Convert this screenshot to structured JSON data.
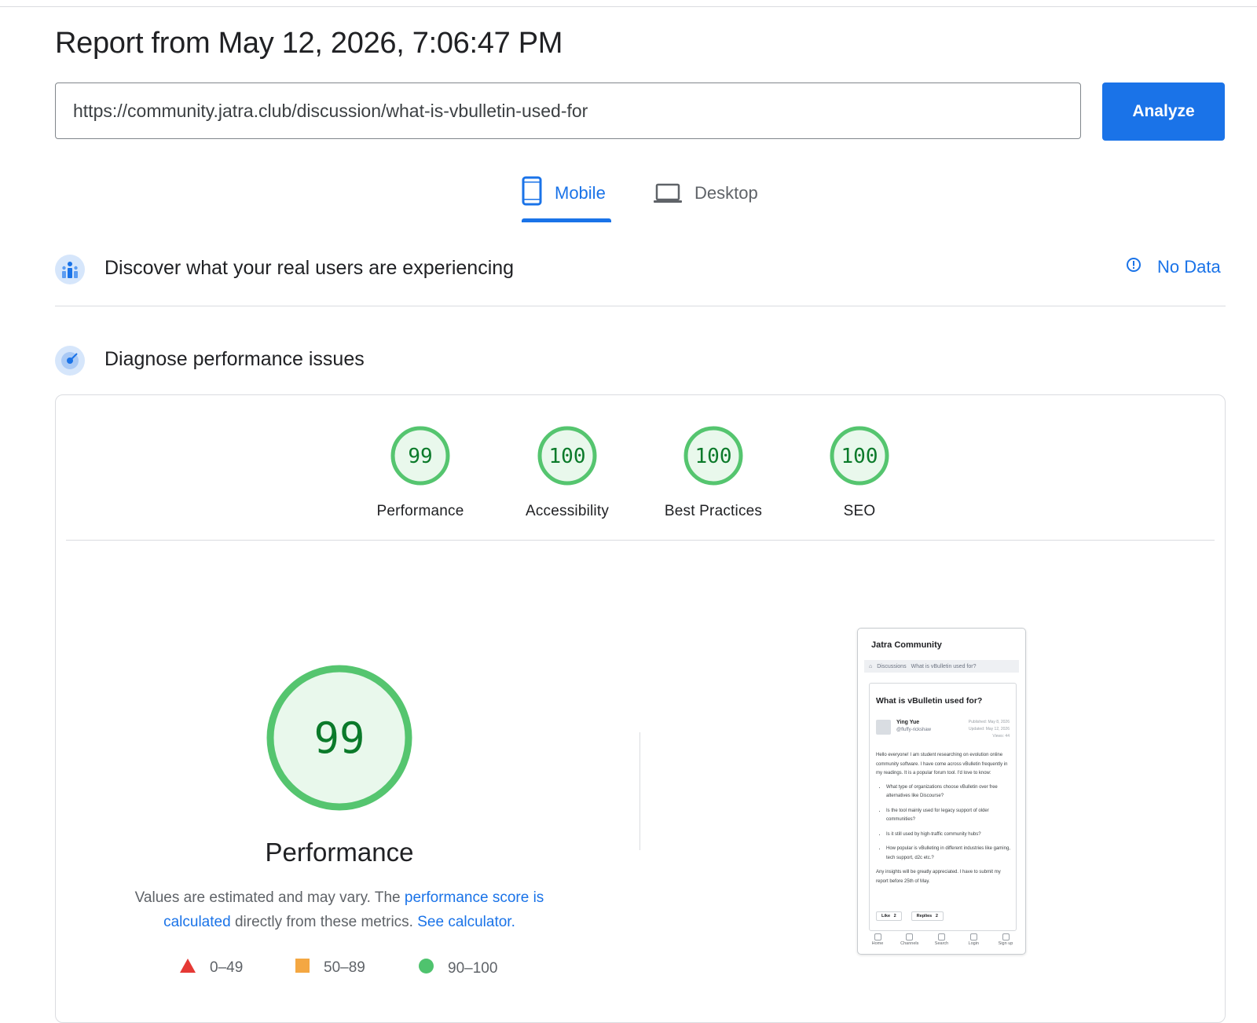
{
  "report": {
    "title": "Report from May 12, 2026, 7:06:47 PM"
  },
  "search": {
    "url": "https://community.jatra.club/discussion/what-is-vbulletin-used-for",
    "analyze_label": "Analyze"
  },
  "tabs": [
    {
      "label": "Mobile",
      "icon": "smartphone-icon",
      "active": true
    },
    {
      "label": "Desktop",
      "icon": "laptop-icon",
      "active": false
    }
  ],
  "field_data": {
    "title": "Discover what your real users are experiencing",
    "status": "No Data"
  },
  "lab_data": {
    "title": "Diagnose performance issues",
    "categories": [
      {
        "label": "Performance",
        "score": 99
      },
      {
        "label": "Accessibility",
        "score": 100
      },
      {
        "label": "Best Practices",
        "score": 100
      },
      {
        "label": "SEO",
        "score": 100
      }
    ]
  },
  "performance": {
    "score": 99,
    "title": "Performance",
    "desc_prefix": "Values are estimated and may vary. The ",
    "desc_link1": "performance score is calculated",
    "desc_middle": " directly from these metrics. ",
    "desc_link2": "See calculator.",
    "legend": [
      {
        "range": "0–49",
        "shape": "triangle",
        "color": "#e53935"
      },
      {
        "range": "50–89",
        "shape": "square",
        "color": "#f4a742"
      },
      {
        "range": "90–100",
        "shape": "circle",
        "color": "#4fc36e"
      }
    ]
  },
  "colors": {
    "accent": "#1a73e8",
    "pass_green": "#55c56f",
    "pass_fill": "#e9f8ec",
    "pass_text": "#0b7a2a"
  },
  "thumbnail": {
    "brand": "Jatra Community",
    "crumbs": [
      "Discussions",
      "What is vBulletin used for?"
    ],
    "post_title": "What is vBulletin used for?",
    "author": "Ying Yue",
    "handle": "@fluffy-rickshaw",
    "published": "Published: May 8, 2026",
    "updated": "Updated: May 12, 2026",
    "views": "Views: 44",
    "intro": "Hello everyone! I am student researching on evolution online community software. I have come across vBulletin frequently in my readings. It is a popular forum tool. I'd love to know:",
    "bullets": [
      "What type of organizations choose vBulletin over free alternatives like Discourse?",
      "Is the tool mainly used for legacy support of older communities?",
      "Is it still used by high-traffic community hubs?",
      "How popular is vBulleting in different industries like gaming, tech support, d2c etc.?"
    ],
    "outro": "Any insights will be greatly appreciated. I have to submit my report before 25th of May.",
    "like_label": "Like",
    "like_count": "2",
    "replies_label": "Replies",
    "replies_count": "2",
    "nav": [
      "Home",
      "Channels",
      "Search",
      "Login",
      "Sign up"
    ]
  }
}
